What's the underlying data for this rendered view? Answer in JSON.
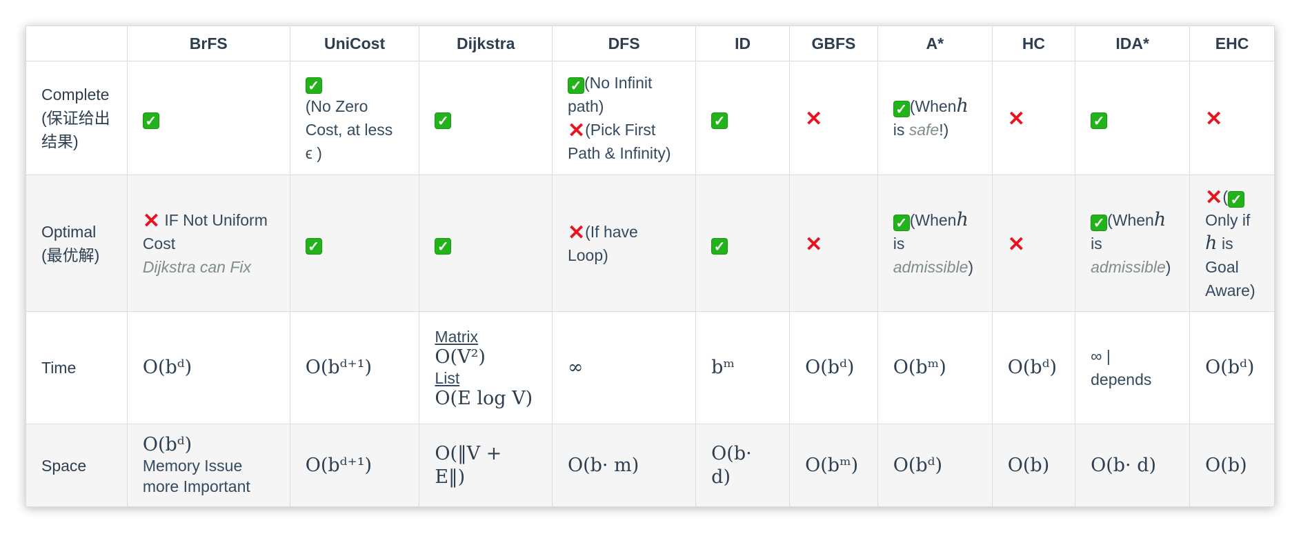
{
  "headers": [
    "",
    "BrFS",
    "UniCost",
    "Dijkstra",
    "DFS",
    "ID",
    "GBFS",
    "A*",
    "HC",
    "IDA*",
    "EHC"
  ],
  "rows": {
    "complete": {
      "label": "Complete (保证给出结果)",
      "unicost_note": "(No Zero Cost, at less ϵ )",
      "dfs_ok_note": "(No Infinit path)",
      "dfs_no_note": "(Pick First Path & Infinity)",
      "astar_note_a": "(When",
      "astar_var": "h",
      "astar_note_b": " is ",
      "astar_note_em": "safe",
      "astar_note_c": "!)"
    },
    "optimal": {
      "label": "Optimal (最优解)",
      "brfs_note": " IF Not Uniform Cost",
      "brfs_fix": "Dijkstra can Fix",
      "dfs_note": "(If have Loop)",
      "astar_note_a": "(When",
      "astar_var": "h",
      "astar_note_b": " is ",
      "astar_note_em": "admissible",
      "astar_note_c": ")",
      "idastar_note_a": "(When",
      "idastar_var": "h",
      "idastar_note_b": " is ",
      "idastar_note_em": "admissible",
      "idastar_note_c": ")",
      "ehc_open": "(",
      "ehc_note_a": " Only if ",
      "ehc_var": "h",
      "ehc_note_b": " is Goal Aware)"
    },
    "time": {
      "label": "Time",
      "brfs": "O(bᵈ)",
      "unicost": "O(bᵈ⁺¹)",
      "dijkstra_matrix_label": "Matrix",
      "dijkstra_matrix": "O(V²)",
      "dijkstra_list_label": "List",
      "dijkstra_list": "O(E log V)",
      "dfs": "∞",
      "id": "bᵐ",
      "gbfs": "O(bᵈ)",
      "astar": "O(bᵐ)",
      "hc": "O(bᵈ)",
      "idastar": "∞ | depends",
      "ehc": "O(bᵈ)"
    },
    "space": {
      "label": "Space",
      "brfs": "O(bᵈ)",
      "brfs_note": "Memory Issue more Important",
      "unicost": "O(bᵈ⁺¹)",
      "dijkstra": "O(‖V + E‖)",
      "dfs": "O(b· m)",
      "id": "O(b· d)",
      "gbfs": "O(bᵐ)",
      "astar": "O(bᵈ)",
      "hc": "O(b)",
      "idastar": "O(b· d)",
      "ehc": "O(b)"
    }
  },
  "icons": {
    "check": "check-mark-icon",
    "cross": "cross-mark-icon"
  },
  "colors": {
    "check": "#22b21a",
    "cross": "#e8131e",
    "header_text": "#2c3e50",
    "alt_row": "#f5f5f5"
  }
}
